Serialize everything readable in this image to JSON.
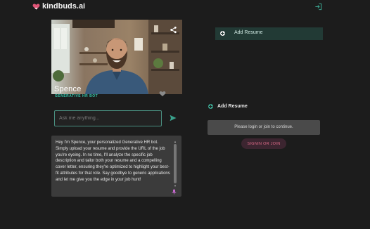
{
  "header": {
    "brand": "kindbuds.ai",
    "logo_icon": "heart-logo-icon",
    "login_icon": "login-arrow-icon"
  },
  "bot": {
    "name": "Spence",
    "subtitle": "GENERATIVE HR BOT",
    "photo": "portrait of a smiling bearded man in a denim shirt in a cafe",
    "description": "Hey I'm Spence, your personalized Generative HR bot. Simply upload your resume and provide the URL of the job you're eyeing. In no time, I'll analyze the specific job description and tailor both your resume and a compelling cover letter, ensuring they're optimized to highlight your best-fit attributes for that role. Say goodbye to generic applications and let me give you the edge in your job hunt!"
  },
  "chat": {
    "placeholder": "Ask me anything...",
    "value": ""
  },
  "resume_panel": {
    "add_resume_tab": "Add Resume",
    "heading": "Add Resume",
    "notice": "Please login or join to continue.",
    "signin_label": "SIGNIN OR JOIN"
  },
  "colors": {
    "background": "#1c1c1c",
    "accent": "#33c4a9",
    "signin_text": "#e06c8a",
    "heart": "#e05577"
  }
}
